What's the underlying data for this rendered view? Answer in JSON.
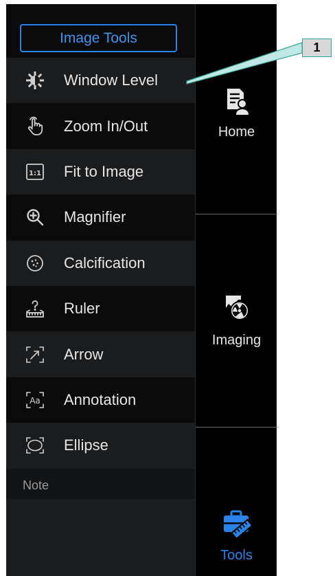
{
  "panel": {
    "header_button": "Image Tools",
    "tools": [
      {
        "label": "Window Level",
        "icon": "brightness-gear-icon"
      },
      {
        "label": "Zoom In/Out",
        "icon": "hand-pointer-icon"
      },
      {
        "label": "Fit to Image",
        "icon": "one-to-one-icon"
      },
      {
        "label": "Magnifier",
        "icon": "magnifier-plus-icon"
      },
      {
        "label": "Calcification",
        "icon": "calcification-icon"
      },
      {
        "label": "Ruler",
        "icon": "ruler-icon"
      },
      {
        "label": "Arrow",
        "icon": "arrow-icon"
      },
      {
        "label": "Annotation",
        "icon": "annotation-icon"
      },
      {
        "label": "Ellipse",
        "icon": "ellipse-icon"
      }
    ],
    "note_label": "Note"
  },
  "nav": {
    "home": "Home",
    "imaging": "Imaging",
    "tools": "Tools"
  },
  "callout": {
    "number": "1"
  },
  "colors": {
    "accent": "#2a83e6",
    "callout_line": "#3aa39e"
  }
}
